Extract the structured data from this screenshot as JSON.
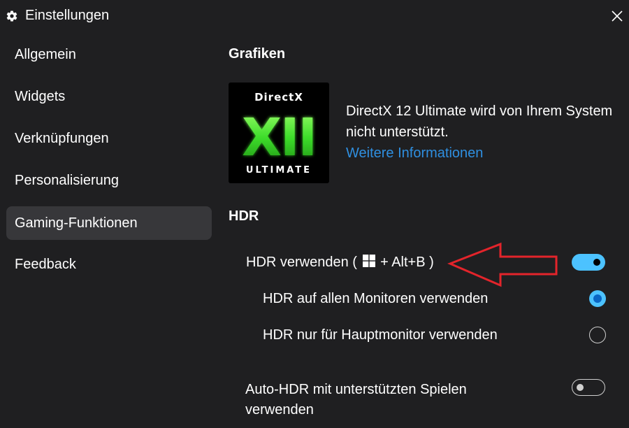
{
  "window": {
    "title": "Einstellungen",
    "close_icon": "close-icon",
    "title_icon": "gear-icon"
  },
  "sidebar": {
    "items": [
      {
        "label": "Allgemein",
        "active": false
      },
      {
        "label": "Widgets",
        "active": false
      },
      {
        "label": "Verknüpfungen",
        "active": false
      },
      {
        "label": "Personalisierung",
        "active": false
      },
      {
        "label": "Gaming-Funktionen",
        "active": true
      },
      {
        "label": "Feedback",
        "active": false
      }
    ]
  },
  "main": {
    "graphics": {
      "title": "Grafiken",
      "logo": {
        "top_text": "DirectX",
        "numeral": "XII",
        "bottom_text": "ULTIMATE"
      },
      "description": "DirectX 12 Ultimate wird von Ihrem System nicht unterstützt.",
      "link": "Weitere Informationen"
    },
    "hdr": {
      "title": "HDR",
      "use_hdr": {
        "label_prefix": "HDR verwenden (",
        "shortcut_icon": "windows-key-icon",
        "label_suffix": "+ Alt+B )",
        "enabled": true
      },
      "all_monitors": {
        "label": "HDR auf allen Monitoren verwenden",
        "selected": true
      },
      "main_monitor": {
        "label": "HDR nur für Hauptmonitor verwenden",
        "selected": false
      },
      "auto_hdr": {
        "label_line1": "Auto-HDR mit unterstützten Spielen",
        "label_line2": "verwenden",
        "enabled": false
      }
    }
  },
  "colors": {
    "background": "#1f1f21",
    "active_item": "#37373a",
    "accent": "#4cc2ff",
    "link": "#2f8fe0",
    "annotation_arrow": "#e3242b",
    "logo_green": "#3ddc2a"
  }
}
